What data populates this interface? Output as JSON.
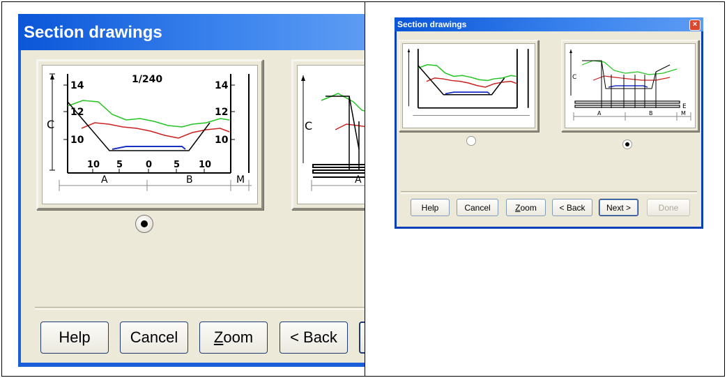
{
  "dialog": {
    "title": "Section drawings",
    "close_glyph": "×",
    "buttons": {
      "help": "Help",
      "cancel": "Cancel",
      "zoom_prefix": "",
      "zoom_accel": "Z",
      "zoom_rest": "oom",
      "back": "< Back",
      "next": "Next >",
      "done": "Done"
    },
    "options": [
      {
        "id": "drawing-a",
        "selected": false
      },
      {
        "id": "drawing-b",
        "selected": true
      }
    ]
  },
  "zoom_view": {
    "title": "Section drawings",
    "buttons": {
      "help": "Help",
      "cancel": "Cancel",
      "zoom_accel": "Z",
      "zoom_rest": "oom",
      "back": "< Back"
    },
    "selected_option": "drawing-a"
  },
  "drawing_a": {
    "scale": "1/240",
    "left_ticks": [
      "14",
      "12",
      "10"
    ],
    "right_ticks": [
      "14",
      "12",
      "10"
    ],
    "bottom_ticks": [
      "10",
      "5",
      "0",
      "5",
      "10"
    ],
    "height_label": "C",
    "dim_labels": [
      "A",
      "B",
      "M"
    ]
  },
  "drawing_b": {
    "height_label": "C",
    "dim_labels": [
      "A",
      "B",
      "M"
    ],
    "end_label": "E"
  },
  "colors": {
    "title_bar": "#0a56d8",
    "dialog_bg": "#ece9d8",
    "profile_green": "#22c422",
    "profile_red": "#cc2020",
    "channel_blue": "#1a2fc8",
    "close_red": "#d9482f"
  }
}
